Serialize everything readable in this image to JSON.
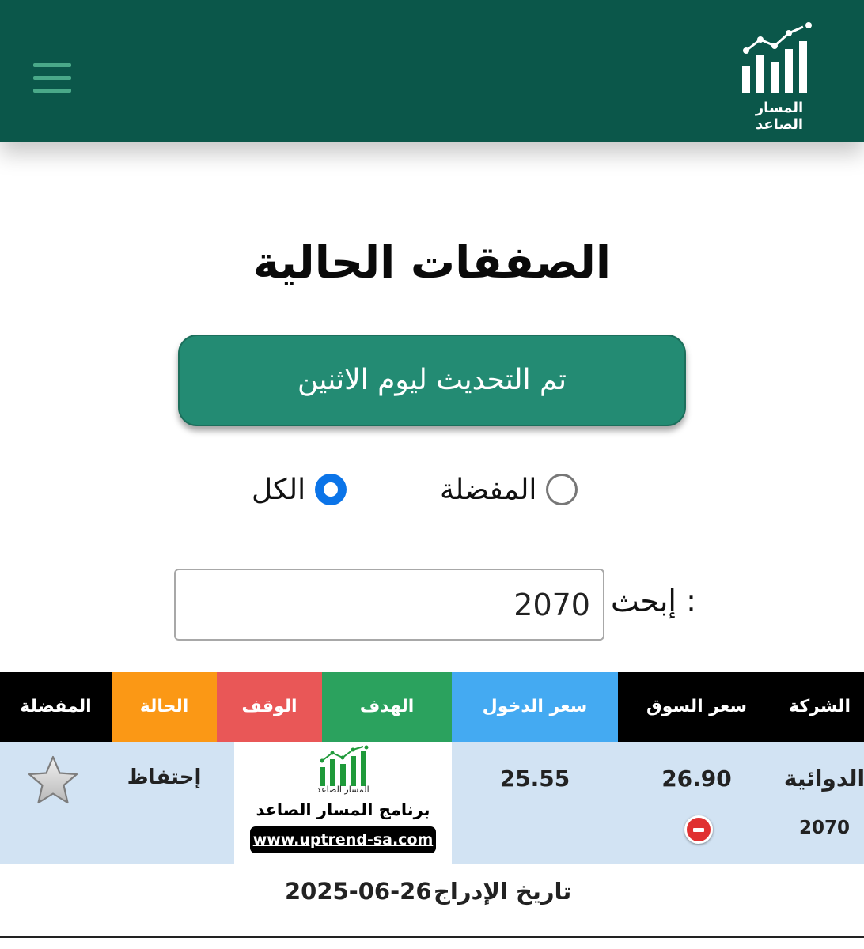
{
  "header": {
    "logo_caption": "المسار الصاعد"
  },
  "page_title": "الصفقات الحالية",
  "update_button": "تم التحديث ليوم الاثنين",
  "filters": {
    "favorites_label": "المفضلة",
    "all_label": "الكل",
    "selected": "الكل"
  },
  "search": {
    "label": "إبحث :",
    "value": "2070"
  },
  "table": {
    "headers": {
      "company": "الشركة",
      "market_price": "سعر السوق",
      "entry_price": "سعر الدخول",
      "target": "الهدف",
      "stop": "الوقف",
      "status": "الحالة",
      "favorite": "المفضلة"
    },
    "header_colors": {
      "company": "#000000",
      "market_price": "#000000",
      "entry_price": "#44aaf2",
      "target": "#2ba25e",
      "stop": "#e95757",
      "status": "#fb9815",
      "favorite": "#000000"
    },
    "rows": [
      {
        "company": "الدوائية",
        "code": "2070",
        "market_price": "26.90",
        "entry_price": "25.55",
        "status": "إحتفاظ",
        "listing_label": "تاريخ الإدراج",
        "listing_date": "2025-06-26"
      }
    ]
  },
  "watermark": {
    "caption": "المسار الصاعد",
    "title": "برنامج المسار الصاعد",
    "url": "www.uptrend-sa.com"
  },
  "colors": {
    "header_bg": "#0b574a",
    "button_bg": "#238b73",
    "row_bg": "#d2e3f3",
    "radio_selected": "#0b74e8"
  }
}
